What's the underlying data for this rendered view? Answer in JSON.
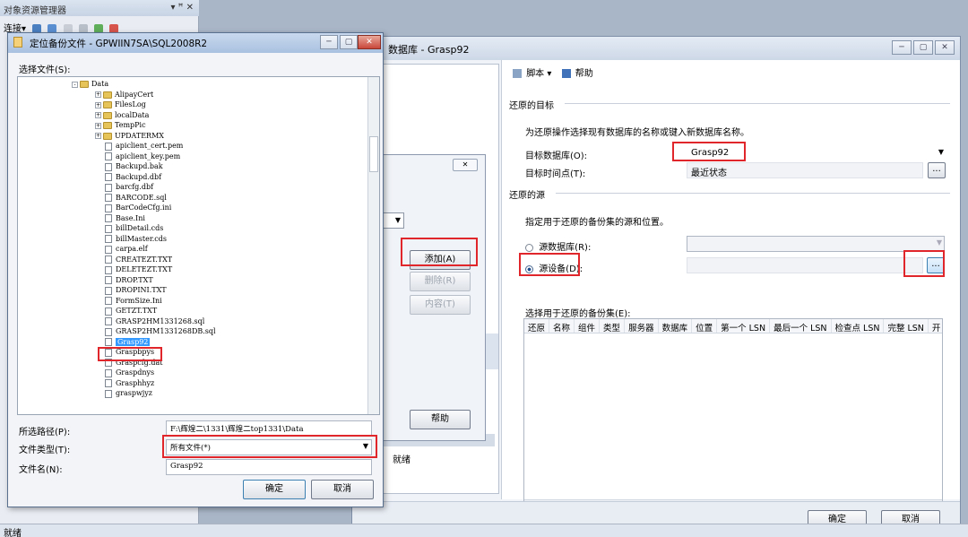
{
  "object_explorer": {
    "title": "对象资源管理器",
    "title_controls": "▾ ꟸ ✕",
    "connect_label": "连接▾"
  },
  "status_bar": {
    "text": "就绪"
  },
  "restore_window": {
    "title": "数据库 - Grasp92",
    "toolbar": {
      "script_label": "脚本 ▾",
      "help_label": "帮助"
    },
    "destination_section": "还原的目标",
    "destination_hint": "为还原操作选择现有数据库的名称或键入新数据库名称。",
    "target_db_label": "目标数据库(O):",
    "target_db_value": "Grasp92",
    "target_time_label": "目标时间点(T):",
    "target_time_value": "最近状态",
    "source_section": "还原的源",
    "source_hint": "指定用于还原的备份集的源和位置。",
    "source_db_label": "源数据库(R):",
    "source_device_label": "源设备(D):",
    "backupsets_label": "选择用于还原的备份集(E):",
    "grid_columns": [
      "还原",
      "名称",
      "组件",
      "类型",
      "服务器",
      "数据库",
      "位置",
      "第一个 LSN",
      "最后一个 LSN",
      "检查点 LSN",
      "完整 LSN",
      "开"
    ],
    "left_status": "就绪",
    "ok_label": "确定",
    "cancel_label": "取消",
    "browse_label": "..."
  },
  "middle_dialog": {
    "close_label": "✕",
    "add_label": "添加(A)",
    "remove_label": "删除(R)",
    "contents_label": "内容(T)",
    "help_label": "帮助"
  },
  "file_dialog": {
    "title": "定位备份文件 - GPWIIN7SA\\SQL2008R2",
    "select_file_label": "选择文件(S):",
    "tree": [
      {
        "type": "folder",
        "level": 0,
        "label": "Data",
        "expander": "-"
      },
      {
        "type": "folder",
        "level": 1,
        "label": "AlipayCert",
        "expander": "+"
      },
      {
        "type": "folder",
        "level": 1,
        "label": "FilesLog",
        "expander": "+"
      },
      {
        "type": "folder",
        "level": 1,
        "label": "localData",
        "expander": "+"
      },
      {
        "type": "folder",
        "level": 1,
        "label": "TempPic",
        "expander": "+"
      },
      {
        "type": "folder",
        "level": 1,
        "label": "UPDATERMX",
        "expander": "+"
      },
      {
        "type": "file",
        "level": 1,
        "label": "apiclient_cert.pem"
      },
      {
        "type": "file",
        "level": 1,
        "label": "apiclient_key.pem"
      },
      {
        "type": "file",
        "level": 1,
        "label": "Backupd.bak"
      },
      {
        "type": "file",
        "level": 1,
        "label": "Backupd.dbf"
      },
      {
        "type": "file",
        "level": 1,
        "label": "barcfg.dbf"
      },
      {
        "type": "file",
        "level": 1,
        "label": "BARCODE.sql"
      },
      {
        "type": "file",
        "level": 1,
        "label": "BarCodeCfg.ini"
      },
      {
        "type": "file",
        "level": 1,
        "label": "Base.Ini"
      },
      {
        "type": "file",
        "level": 1,
        "label": "billDetail.cds"
      },
      {
        "type": "file",
        "level": 1,
        "label": "billMaster.cds"
      },
      {
        "type": "file",
        "level": 1,
        "label": "carpa.elf"
      },
      {
        "type": "file",
        "level": 1,
        "label": "CREATEZT.TXT"
      },
      {
        "type": "file",
        "level": 1,
        "label": "DELETEZT.TXT"
      },
      {
        "type": "file",
        "level": 1,
        "label": "DROP.TXT"
      },
      {
        "type": "file",
        "level": 1,
        "label": "DROPINI.TXT"
      },
      {
        "type": "file",
        "level": 1,
        "label": "FormSize.Ini"
      },
      {
        "type": "file",
        "level": 1,
        "label": "GETZT.TXT"
      },
      {
        "type": "file",
        "level": 1,
        "label": "GRASP2HM1331268.sql"
      },
      {
        "type": "file",
        "level": 1,
        "label": "GRASP2HM1331268DB.sql"
      },
      {
        "type": "file",
        "level": 1,
        "label": "Grasp92",
        "selected": true
      },
      {
        "type": "file",
        "level": 1,
        "label": "Graspbpys"
      },
      {
        "type": "file",
        "level": 1,
        "label": "Graspcfg.dat"
      },
      {
        "type": "file",
        "level": 1,
        "label": "Graspdnys"
      },
      {
        "type": "file",
        "level": 1,
        "label": "Grasphhyz"
      },
      {
        "type": "file",
        "level": 1,
        "label": "graspwjyz"
      }
    ],
    "path_label": "所选路径(P):",
    "path_value": "F:\\辉煌二\\1331\\辉煌二top1331\\Data",
    "type_label": "文件类型(T):",
    "type_value": "所有文件(*)",
    "name_label": "文件名(N):",
    "name_value": "Grasp92",
    "ok_label": "确定",
    "cancel_label": "取消"
  },
  "colors": {
    "highlight": "#e0262b",
    "selection": "#3399ff"
  }
}
